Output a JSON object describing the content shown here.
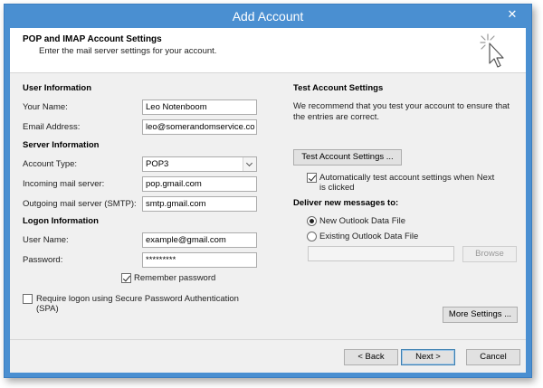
{
  "window": {
    "title": "Add Account",
    "close_glyph": "✕"
  },
  "header": {
    "title": "POP and IMAP Account Settings",
    "subtitle": "Enter the mail server settings for your account.",
    "icon": "sparkle-cursor-icon"
  },
  "user_info": {
    "heading": "User Information",
    "name_label": "Your Name:",
    "name_value": "Leo Notenboom",
    "email_label": "Email Address:",
    "email_value": "leo@somerandomservice.co"
  },
  "server_info": {
    "heading": "Server Information",
    "account_type_label": "Account Type:",
    "account_type_value": "POP3",
    "incoming_label": "Incoming mail server:",
    "incoming_value": "pop.gmail.com",
    "outgoing_label": "Outgoing mail server (SMTP):",
    "outgoing_value": "smtp.gmail.com"
  },
  "logon_info": {
    "heading": "Logon Information",
    "username_label": "User Name:",
    "username_value": "example@gmail.com",
    "password_label": "Password:",
    "password_value": "*********",
    "remember_label": "Remember password",
    "remember_checked": true,
    "spa_label_line1": "Require logon using Secure Password Authentication",
    "spa_label_line2": "(SPA)",
    "spa_checked": false
  },
  "test_settings": {
    "heading": "Test Account Settings",
    "description_line1": "We recommend that you test your account to ensure that",
    "description_line2": "the entries are correct.",
    "test_button": "Test Account Settings ...",
    "auto_test_line1": "Automatically test account settings when Next",
    "auto_test_line2": "is clicked",
    "auto_test_checked": true
  },
  "deliver": {
    "heading": "Deliver new messages to:",
    "option_new": "New Outlook Data File",
    "option_existing": "Existing Outlook Data File",
    "selected": "new",
    "existing_path": "",
    "browse_button": "Browse"
  },
  "more_settings_button": "More Settings ...",
  "footer": {
    "back_button": "< Back",
    "next_button": "Next >",
    "cancel_button": "Cancel"
  },
  "colors": {
    "title_bar": "#4a8fd1",
    "dialog_bg": "#f0f0f0",
    "header_bg": "#ffffff"
  }
}
